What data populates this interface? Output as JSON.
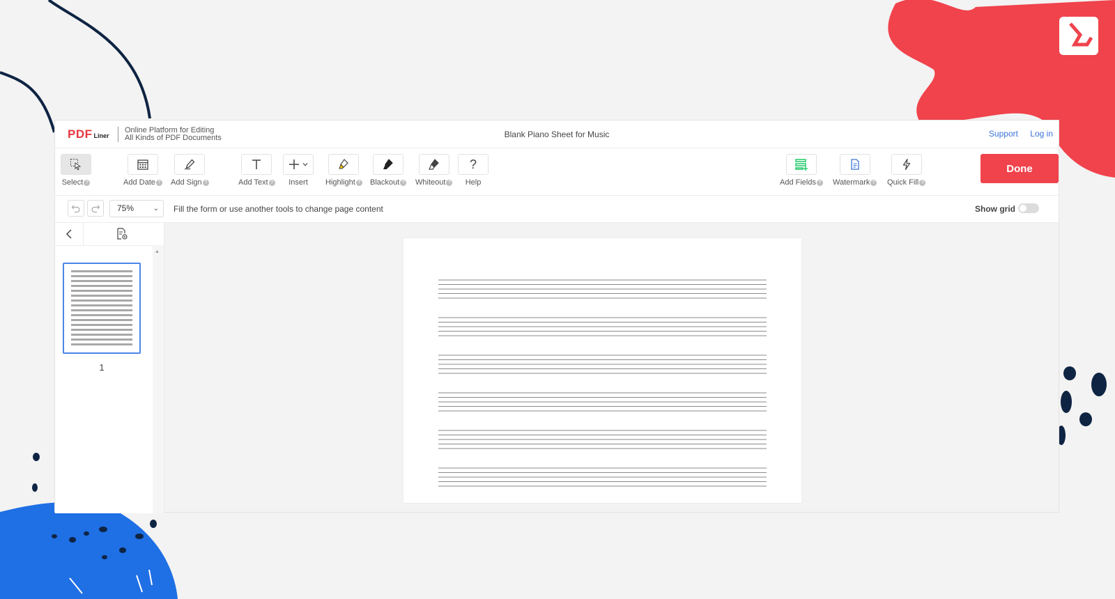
{
  "header": {
    "logo_main": "PDF",
    "logo_sub": "Liner",
    "tagline_line1": "Online Platform for Editing",
    "tagline_line2": "All Kinds of PDF Documents",
    "document_title": "Blank Piano Sheet for Music",
    "support_link": "Support",
    "login_link": "Log in"
  },
  "toolbar": {
    "select": "Select",
    "add_date": "Add Date",
    "add_sign": "Add Sign",
    "add_text": "Add Text",
    "insert": "Insert",
    "highlight": "Highlight",
    "blackout": "Blackout",
    "whiteout": "Whiteout",
    "help": "Help",
    "add_fields": "Add Fields",
    "watermark": "Watermark",
    "quick_fill": "Quick Fill",
    "done": "Done",
    "help_badge": "?",
    "help_glyph": "?"
  },
  "options": {
    "zoom": "75%",
    "hint": "Fill the form or use another tools to change page content",
    "show_grid": "Show grid",
    "show_grid_on": false
  },
  "sidebar": {
    "page_number": "1"
  },
  "document": {
    "staves": 6,
    "lines_per_staff": 5
  },
  "colors": {
    "accent_red": "#f0434c",
    "link_blue": "#3b74d8",
    "selection_blue": "#4a86e8",
    "add_fields_green": "#2ecc71"
  },
  "icons": {
    "select": "select-cursor-icon",
    "add_date": "calendar-icon",
    "add_sign": "pen-icon",
    "add_text": "text-t-icon",
    "insert": "plus-icon",
    "highlight": "highlighter-icon",
    "blackout": "blackout-brush-icon",
    "whiteout": "whiteout-eraser-icon",
    "help": "question-icon",
    "add_fields": "fields-icon",
    "watermark": "watermark-icon",
    "quick_fill": "lightning-icon",
    "undo": "undo-icon",
    "redo": "redo-icon",
    "back": "chevron-left-icon",
    "page_settings": "page-settings-icon"
  }
}
